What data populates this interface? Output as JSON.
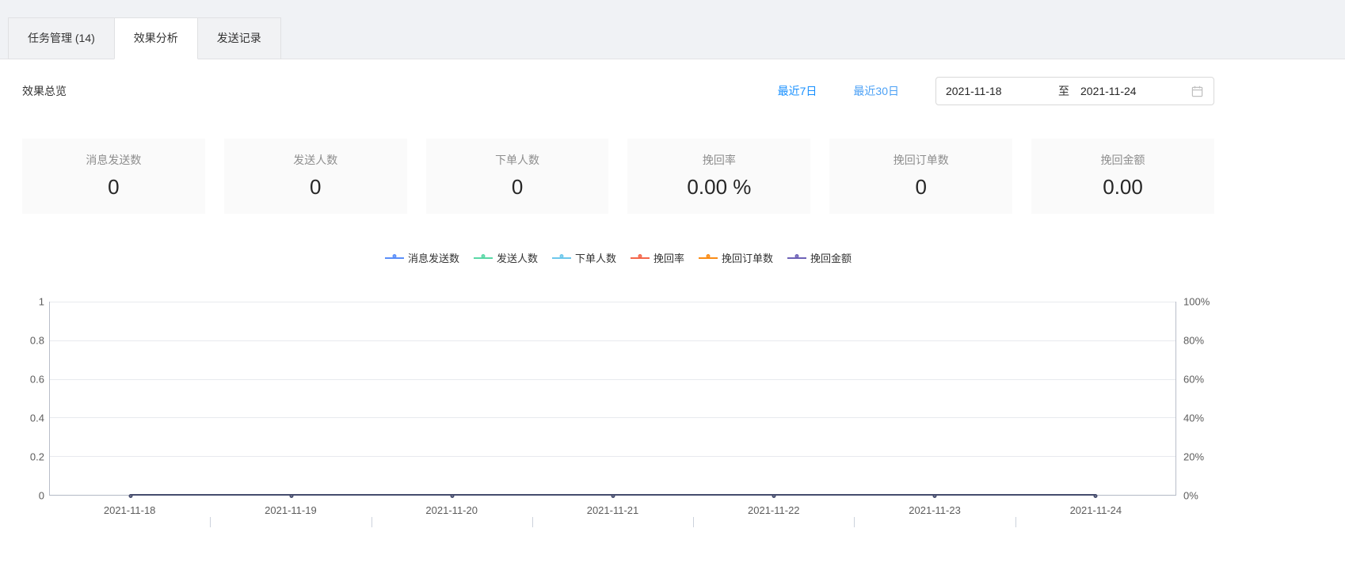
{
  "tabs": [
    {
      "label": "任务管理 (14)",
      "active": false
    },
    {
      "label": "效果分析",
      "active": true
    },
    {
      "label": "发送记录",
      "active": false
    }
  ],
  "overview": {
    "title": "效果总览",
    "quick_ranges": [
      {
        "label": "最近7日"
      },
      {
        "label": "最近30日"
      }
    ],
    "date_picker": {
      "start": "2021-11-18",
      "separator": "至",
      "end": "2021-11-24"
    }
  },
  "stats": [
    {
      "label": "消息发送数",
      "value": "0"
    },
    {
      "label": "发送人数",
      "value": "0"
    },
    {
      "label": "下单人数",
      "value": "0"
    },
    {
      "label": "挽回率",
      "value": "0.00 %"
    },
    {
      "label": "挽回订单数",
      "value": "0"
    },
    {
      "label": "挽回金额",
      "value": "0.00"
    }
  ],
  "chart_data": {
    "type": "line",
    "title": "",
    "x": [
      "2021-11-18",
      "2021-11-19",
      "2021-11-20",
      "2021-11-21",
      "2021-11-22",
      "2021-11-23",
      "2021-11-24"
    ],
    "series": [
      {
        "name": "消息发送数",
        "color": "#5B8FF9",
        "values": [
          0,
          0,
          0,
          0,
          0,
          0,
          0
        ]
      },
      {
        "name": "发送人数",
        "color": "#5AD8A6",
        "values": [
          0,
          0,
          0,
          0,
          0,
          0,
          0
        ]
      },
      {
        "name": "下单人数",
        "color": "#6DC8EC",
        "values": [
          0,
          0,
          0,
          0,
          0,
          0,
          0
        ]
      },
      {
        "name": "挽回率",
        "color": "#F4664A",
        "values": [
          0,
          0,
          0,
          0,
          0,
          0,
          0
        ]
      },
      {
        "name": "挽回订单数",
        "color": "#FA8C16",
        "values": [
          0,
          0,
          0,
          0,
          0,
          0,
          0
        ]
      },
      {
        "name": "挽回金额",
        "color": "#6E62B7",
        "values": [
          0,
          0,
          0,
          0,
          0,
          0,
          0
        ]
      }
    ],
    "left_axis": {
      "min": 0,
      "max": 1,
      "ticks_top_to_bottom": [
        "1",
        "0.8",
        "0.6",
        "0.4",
        "0.2",
        "0"
      ]
    },
    "right_axis": {
      "min": 0,
      "max": 100,
      "ticks_top_to_bottom": [
        "100%",
        "80%",
        "60%",
        "40%",
        "20%",
        "0%"
      ]
    },
    "legend_position": "top-center",
    "grid": true,
    "flat_line_color": "#454c6d"
  },
  "colors": {
    "accent": "#1890ff",
    "header_bg": "#f0f2f5",
    "card_bg": "#fafafa"
  }
}
